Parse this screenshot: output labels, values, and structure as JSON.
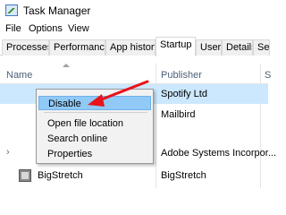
{
  "window": {
    "title": "Task Manager"
  },
  "menu": [
    "File",
    "Options",
    "View"
  ],
  "tabs": [
    "Processes",
    "Performance",
    "App history",
    "Startup",
    "Users",
    "Details",
    "Se"
  ],
  "active_tab": "Startup",
  "columns": {
    "name": "Name",
    "publisher": "Publisher",
    "status": "S"
  },
  "rows": [
    {
      "name": "",
      "publisher": "Spotify Ltd",
      "selected": true
    },
    {
      "name": "",
      "publisher": "Mailbird"
    },
    {
      "name": "",
      "publisher": "Adobe Systems Incorpor..."
    },
    {
      "name": "BigStretch",
      "publisher": "BigStretch"
    }
  ],
  "context_menu": [
    "Disable",
    "Open file location",
    "Search online",
    "Properties"
  ],
  "colors": {
    "selection": "#cce8ff",
    "menu_highlight": "#91c9f7",
    "arrow": "#e8131b"
  },
  "icons": {
    "app": "task-manager-icon",
    "row": "app-icon"
  }
}
